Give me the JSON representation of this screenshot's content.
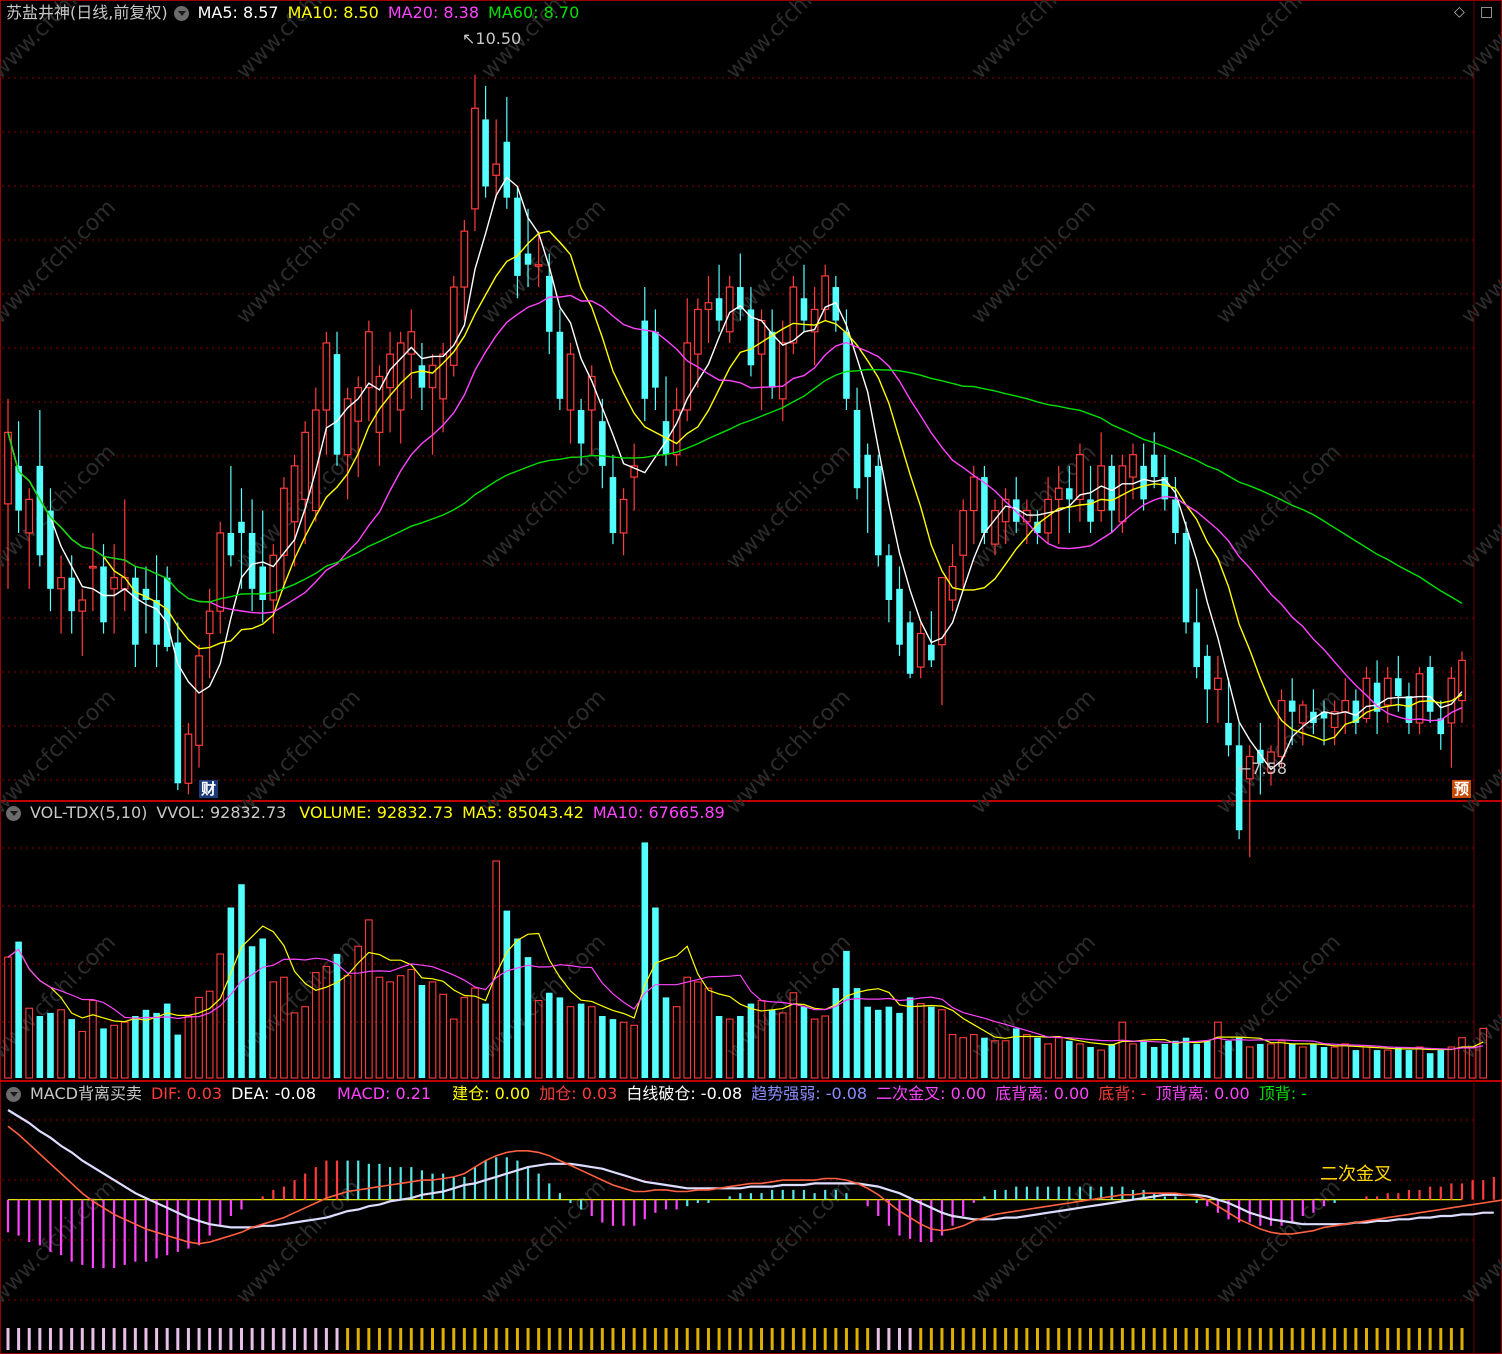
{
  "header": {
    "title": "苏盐井神(日线,前复权)",
    "ma5": "MA5: 8.57",
    "ma10": "MA10: 8.50",
    "ma20": "MA20: 8.38",
    "ma60": "MA60: 8.70"
  },
  "vol_header": {
    "name": "VOL-TDX(5,10)",
    "vvol": "VVOL: 92832.73",
    "volume": "VOLUME: 92832.73",
    "ma5": "MA5: 85043.42",
    "ma10": "MA10: 67665.89"
  },
  "macd_header": {
    "name": "MACD背离买卖",
    "dif": "DIF: 0.03",
    "dea": "DEA: -0.08",
    "macd": "MACD: 0.21",
    "jiancang": "建仓: 0.00",
    "jiacang": "加仓: 0.03",
    "baixian": "白线破仓: -0.08",
    "qushi": "趋势强弱: -0.08",
    "erci": "二次金叉: 0.00",
    "dibeili": "底背离: 0.00",
    "dibei": "底背: -",
    "dingbeili": "顶背离: 0.00",
    "dingbei": "顶背: -"
  },
  "annotations": {
    "high": "10.50",
    "low": "7.58",
    "erci_label": "二次金叉",
    "cai_badge": "财",
    "yu_badge": "预",
    "watermark": "www.cfchi.com"
  },
  "colors": {
    "up": "#ff3b3b",
    "down": "#54ffff",
    "ma5": "#ffffff",
    "ma10": "#ffff00",
    "ma20": "#ff44ff",
    "ma60": "#00e000",
    "grid": "#8a0000"
  },
  "chart_data": [
    {
      "type": "candlestick",
      "title": "苏盐井神(日线,前复权)",
      "ylim": [
        7.3,
        10.7
      ],
      "yhigh": 10.5,
      "ylow": 7.58,
      "ohlc": [
        [
          8.58,
          9.05,
          8.2,
          8.9
        ],
        [
          8.75,
          8.95,
          8.45,
          8.55
        ],
        [
          8.45,
          8.65,
          8.2,
          8.6
        ],
        [
          8.75,
          9.0,
          8.3,
          8.35
        ],
        [
          8.55,
          8.65,
          8.1,
          8.2
        ],
        [
          8.2,
          8.35,
          8.0,
          8.25
        ],
        [
          8.25,
          8.35,
          8.0,
          8.1
        ],
        [
          8.1,
          8.2,
          7.9,
          8.15
        ],
        [
          8.3,
          8.45,
          8.1,
          8.3
        ],
        [
          8.3,
          8.4,
          8.0,
          8.05
        ],
        [
          8.2,
          8.4,
          8.0,
          8.25
        ],
        [
          8.2,
          8.6,
          8.1,
          8.25
        ],
        [
          8.25,
          8.3,
          7.85,
          7.95
        ],
        [
          8.2,
          8.3,
          8.0,
          8.15
        ],
        [
          8.15,
          8.35,
          7.85,
          7.95
        ],
        [
          8.25,
          8.3,
          7.92,
          7.94
        ],
        [
          7.96,
          8.05,
          7.3,
          7.33
        ],
        [
          7.33,
          7.6,
          7.28,
          7.55
        ],
        [
          7.5,
          7.95,
          7.4,
          7.9
        ],
        [
          8.0,
          8.2,
          7.8,
          8.1
        ],
        [
          8.1,
          8.5,
          8.0,
          8.45
        ],
        [
          8.45,
          8.75,
          8.3,
          8.35
        ],
        [
          8.5,
          8.65,
          8.2,
          8.45
        ],
        [
          8.45,
          8.6,
          8.1,
          8.2
        ],
        [
          8.3,
          8.55,
          8.05,
          8.15
        ],
        [
          8.15,
          8.4,
          8.0,
          8.35
        ],
        [
          8.35,
          8.7,
          8.2,
          8.65
        ],
        [
          8.5,
          8.8,
          8.3,
          8.75
        ],
        [
          8.6,
          8.95,
          8.4,
          8.9
        ],
        [
          8.55,
          9.1,
          8.5,
          9.0
        ],
        [
          9.0,
          9.35,
          8.8,
          9.3
        ],
        [
          9.25,
          9.35,
          8.75,
          8.8
        ],
        [
          8.8,
          9.1,
          8.6,
          9.05
        ],
        [
          8.95,
          9.15,
          8.7,
          9.1
        ],
        [
          9.1,
          9.4,
          8.95,
          9.35
        ],
        [
          8.9,
          9.2,
          8.75,
          9.15
        ],
        [
          9.1,
          9.35,
          8.9,
          9.25
        ],
        [
          9.0,
          9.35,
          8.85,
          9.3
        ],
        [
          9.25,
          9.45,
          9.05,
          9.35
        ],
        [
          9.2,
          9.3,
          9.0,
          9.1
        ],
        [
          9.1,
          9.25,
          8.8,
          9.2
        ],
        [
          9.05,
          9.3,
          8.9,
          9.25
        ],
        [
          9.2,
          9.6,
          9.15,
          9.55
        ],
        [
          9.55,
          9.85,
          9.4,
          9.8
        ],
        [
          9.9,
          10.5,
          9.8,
          10.35
        ],
        [
          10.3,
          10.45,
          9.95,
          10.0
        ],
        [
          10.05,
          10.3,
          9.95,
          10.1
        ],
        [
          10.2,
          10.4,
          9.9,
          9.95
        ],
        [
          9.95,
          10.0,
          9.5,
          9.6
        ],
        [
          9.7,
          9.9,
          9.55,
          9.65
        ],
        [
          9.65,
          9.8,
          9.55,
          9.65
        ],
        [
          9.6,
          9.7,
          9.25,
          9.35
        ],
        [
          9.35,
          9.45,
          9.0,
          9.05
        ],
        [
          9.0,
          9.3,
          8.85,
          9.25
        ],
        [
          9.0,
          9.05,
          8.75,
          8.85
        ],
        [
          9.0,
          9.2,
          8.8,
          9.15
        ],
        [
          8.95,
          9.05,
          8.65,
          8.75
        ],
        [
          8.7,
          8.8,
          8.4,
          8.45
        ],
        [
          8.45,
          8.65,
          8.35,
          8.6
        ],
        [
          8.7,
          8.85,
          8.55,
          8.75
        ],
        [
          9.4,
          9.55,
          8.95,
          9.05
        ],
        [
          9.35,
          9.45,
          9.0,
          9.1
        ],
        [
          8.95,
          9.15,
          8.75,
          8.8
        ],
        [
          8.8,
          9.1,
          8.75,
          9.0
        ],
        [
          9.0,
          9.5,
          8.95,
          9.3
        ],
        [
          9.25,
          9.5,
          9.1,
          9.45
        ],
        [
          9.45,
          9.6,
          9.3,
          9.48
        ],
        [
          9.5,
          9.65,
          9.35,
          9.4
        ],
        [
          9.35,
          9.6,
          9.3,
          9.55
        ],
        [
          9.55,
          9.7,
          9.4,
          9.45
        ],
        [
          9.45,
          9.55,
          9.15,
          9.2
        ],
        [
          9.25,
          9.45,
          9.0,
          9.4
        ],
        [
          9.35,
          9.45,
          9.05,
          9.1
        ],
        [
          9.05,
          9.4,
          8.95,
          9.3
        ],
        [
          9.3,
          9.6,
          9.25,
          9.55
        ],
        [
          9.5,
          9.65,
          9.35,
          9.4
        ],
        [
          9.35,
          9.55,
          9.2,
          9.45
        ],
        [
          9.45,
          9.65,
          9.4,
          9.6
        ],
        [
          9.55,
          9.6,
          9.35,
          9.4
        ],
        [
          9.35,
          9.45,
          9.0,
          9.05
        ],
        [
          9.0,
          9.1,
          8.6,
          8.65
        ],
        [
          8.8,
          8.85,
          8.45,
          8.7
        ],
        [
          8.75,
          8.8,
          8.3,
          8.35
        ],
        [
          8.35,
          8.4,
          8.05,
          8.15
        ],
        [
          8.2,
          8.3,
          7.9,
          7.95
        ],
        [
          8.05,
          8.1,
          7.8,
          7.82
        ],
        [
          7.85,
          8.05,
          7.8,
          8.0
        ],
        [
          7.95,
          8.1,
          7.85,
          7.88
        ],
        [
          7.95,
          8.2,
          7.68,
          8.25
        ],
        [
          8.15,
          8.4,
          8.1,
          8.3
        ],
        [
          8.35,
          8.6,
          8.2,
          8.55
        ],
        [
          8.55,
          8.75,
          8.4,
          8.7
        ],
        [
          8.7,
          8.75,
          8.4,
          8.45
        ],
        [
          8.4,
          8.6,
          8.35,
          8.55
        ],
        [
          8.5,
          8.65,
          8.4,
          8.6
        ],
        [
          8.6,
          8.7,
          8.45,
          8.5
        ],
        [
          8.5,
          8.6,
          8.4,
          8.55
        ],
        [
          8.5,
          8.55,
          8.4,
          8.45
        ],
        [
          8.45,
          8.7,
          8.4,
          8.6
        ],
        [
          8.6,
          8.75,
          8.4,
          8.65
        ],
        [
          8.65,
          8.75,
          8.45,
          8.6
        ],
        [
          8.6,
          8.85,
          8.5,
          8.8
        ],
        [
          8.6,
          8.75,
          8.45,
          8.5
        ],
        [
          8.55,
          8.9,
          8.5,
          8.75
        ],
        [
          8.75,
          8.8,
          8.45,
          8.55
        ],
        [
          8.5,
          8.8,
          8.45,
          8.75
        ],
        [
          8.7,
          8.85,
          8.6,
          8.8
        ],
        [
          8.75,
          8.85,
          8.55,
          8.6
        ],
        [
          8.8,
          8.9,
          8.65,
          8.7
        ],
        [
          8.7,
          8.8,
          8.55,
          8.6
        ],
        [
          8.6,
          8.7,
          8.4,
          8.45
        ],
        [
          8.45,
          8.5,
          8.0,
          8.05
        ],
        [
          8.05,
          8.2,
          7.8,
          7.85
        ],
        [
          7.9,
          7.95,
          7.6,
          7.75
        ],
        [
          7.75,
          7.9,
          7.6,
          7.8
        ],
        [
          7.6,
          7.8,
          7.45,
          7.5
        ],
        [
          7.5,
          7.6,
          7.08,
          7.12
        ],
        [
          7.35,
          7.5,
          7.0,
          7.45
        ],
        [
          7.48,
          7.6,
          7.28,
          7.42
        ],
        [
          7.38,
          7.5,
          7.32,
          7.47
        ],
        [
          7.45,
          7.75,
          7.4,
          7.7
        ],
        [
          7.7,
          7.8,
          7.5,
          7.65
        ],
        [
          7.6,
          7.7,
          7.5,
          7.68
        ],
        [
          7.65,
          7.75,
          7.55,
          7.6
        ],
        [
          7.65,
          7.7,
          7.5,
          7.62
        ],
        [
          7.58,
          7.7,
          7.5,
          7.65
        ],
        [
          7.65,
          7.8,
          7.55,
          7.7
        ],
        [
          7.7,
          7.75,
          7.55,
          7.6
        ],
        [
          7.62,
          7.85,
          7.6,
          7.8
        ],
        [
          7.78,
          7.88,
          7.55,
          7.65
        ],
        [
          7.68,
          7.85,
          7.6,
          7.8
        ],
        [
          7.8,
          7.9,
          7.65,
          7.72
        ],
        [
          7.72,
          7.78,
          7.55,
          7.6
        ],
        [
          7.6,
          7.85,
          7.55,
          7.82
        ],
        [
          7.85,
          7.9,
          7.6,
          7.65
        ],
        [
          7.62,
          7.7,
          7.48,
          7.55
        ],
        [
          7.6,
          7.85,
          7.4,
          7.8
        ],
        [
          7.7,
          7.92,
          7.6,
          7.88
        ]
      ]
    },
    {
      "type": "bar",
      "title": "VOL-TDX(5,10)",
      "ylim": [
        0,
        160000
      ],
      "values": [
        78000,
        88000,
        45000,
        40000,
        42000,
        44000,
        38000,
        30000,
        50000,
        32000,
        34000,
        36000,
        40000,
        44000,
        42000,
        48000,
        28000,
        40000,
        52000,
        56000,
        80000,
        110000,
        125000,
        85000,
        90000,
        62000,
        65000,
        42000,
        46000,
        68000,
        72000,
        80000,
        66000,
        85000,
        102000,
        65000,
        62000,
        66000,
        70000,
        60000,
        62000,
        54000,
        38000,
        52000,
        58000,
        48000,
        140000,
        108000,
        90000,
        78000,
        50000,
        55000,
        52000,
        46000,
        48000,
        46000,
        40000,
        38000,
        36000,
        34000,
        152000,
        110000,
        52000,
        46000,
        65000,
        62000,
        58000,
        40000,
        38000,
        40000,
        48000,
        50000,
        44000,
        42000,
        55000,
        46000,
        38000,
        40000,
        58000,
        82000,
        58000,
        46000,
        44000,
        46000,
        42000,
        52000,
        48000,
        46000,
        44000,
        28000,
        26000,
        28000,
        26000,
        24000,
        24000,
        32000,
        28000,
        26000,
        22000,
        26000,
        24000,
        22000,
        20000,
        18000,
        22000,
        36000,
        22000,
        24000,
        20000,
        22000,
        24000,
        26000,
        22000,
        24000,
        36000,
        24000,
        26000,
        20000,
        22000,
        22000,
        24000,
        22000,
        20000,
        22000,
        20000,
        20000,
        22000,
        18000,
        20000,
        18000,
        18000,
        20000,
        18000,
        20000,
        16000,
        18000,
        20000,
        26000,
        20000,
        32000
      ]
    },
    {
      "type": "line",
      "title": "MACD背离买卖",
      "ylim": [
        -0.75,
        0.55
      ],
      "dif": [
        0.45,
        0.4,
        0.34,
        0.28,
        0.22,
        0.16,
        0.1,
        0.04,
        -0.01,
        -0.05,
        -0.09,
        -0.12,
        -0.15,
        -0.18,
        -0.2,
        -0.22,
        -0.24,
        -0.26,
        -0.27,
        -0.26,
        -0.24,
        -0.22,
        -0.2,
        -0.17,
        -0.15,
        -0.13,
        -0.11,
        -0.08,
        -0.05,
        -0.02,
        0.01,
        0.03,
        0.05,
        0.06,
        0.07,
        0.08,
        0.09,
        0.1,
        0.11,
        0.12,
        0.12,
        0.13,
        0.14,
        0.16,
        0.2,
        0.24,
        0.27,
        0.29,
        0.3,
        0.3,
        0.29,
        0.27,
        0.24,
        0.21,
        0.18,
        0.15,
        0.12,
        0.09,
        0.07,
        0.05,
        0.05,
        0.06,
        0.06,
        0.05,
        0.05,
        0.06,
        0.06,
        0.07,
        0.08,
        0.09,
        0.1,
        0.1,
        0.11,
        0.12,
        0.12,
        0.12,
        0.12,
        0.13,
        0.13,
        0.12,
        0.1,
        0.07,
        0.03,
        -0.02,
        -0.07,
        -0.11,
        -0.15,
        -0.18,
        -0.19,
        -0.18,
        -0.16,
        -0.13,
        -0.11,
        -0.09,
        -0.08,
        -0.07,
        -0.06,
        -0.05,
        -0.04,
        -0.03,
        -0.02,
        -0.01,
        0.0,
        0.01,
        0.02,
        0.03,
        0.03,
        0.04,
        0.04,
        0.04,
        0.04,
        0.03,
        0.02,
        0.0,
        -0.04,
        -0.08,
        -0.12,
        -0.15,
        -0.18,
        -0.2,
        -0.21,
        -0.21,
        -0.2,
        -0.19,
        -0.17,
        -0.16,
        -0.15,
        -0.14,
        -0.13,
        -0.12,
        -0.11,
        -0.1,
        -0.09,
        -0.08,
        -0.07,
        -0.06,
        -0.05,
        -0.04,
        -0.03,
        -0.02,
        -0.01,
        0.0,
        0.03
      ],
      "dea": [
        0.55,
        0.51,
        0.47,
        0.42,
        0.38,
        0.33,
        0.29,
        0.24,
        0.2,
        0.16,
        0.12,
        0.08,
        0.04,
        0.01,
        -0.02,
        -0.05,
        -0.08,
        -0.11,
        -0.13,
        -0.15,
        -0.16,
        -0.17,
        -0.17,
        -0.17,
        -0.16,
        -0.16,
        -0.15,
        -0.14,
        -0.13,
        -0.12,
        -0.11,
        -0.09,
        -0.07,
        -0.06,
        -0.04,
        -0.03,
        -0.01,
        0.0,
        0.01,
        0.03,
        0.04,
        0.05,
        0.07,
        0.09,
        0.1,
        0.12,
        0.14,
        0.16,
        0.18,
        0.2,
        0.21,
        0.22,
        0.22,
        0.22,
        0.21,
        0.2,
        0.19,
        0.17,
        0.15,
        0.13,
        0.11,
        0.1,
        0.09,
        0.08,
        0.07,
        0.07,
        0.07,
        0.07,
        0.07,
        0.07,
        0.08,
        0.08,
        0.08,
        0.09,
        0.09,
        0.09,
        0.1,
        0.1,
        0.1,
        0.1,
        0.1,
        0.09,
        0.08,
        0.06,
        0.04,
        0.01,
        -0.02,
        -0.05,
        -0.08,
        -0.1,
        -0.11,
        -0.12,
        -0.12,
        -0.12,
        -0.11,
        -0.11,
        -0.1,
        -0.09,
        -0.08,
        -0.07,
        -0.06,
        -0.05,
        -0.04,
        -0.03,
        -0.02,
        -0.01,
        0.0,
        0.01,
        0.02,
        0.03,
        0.03,
        0.03,
        0.03,
        0.02,
        0.0,
        -0.02,
        -0.05,
        -0.08,
        -0.1,
        -0.12,
        -0.13,
        -0.14,
        -0.15,
        -0.15,
        -0.15,
        -0.15,
        -0.15,
        -0.14,
        -0.14,
        -0.13,
        -0.13,
        -0.12,
        -0.12,
        -0.11,
        -0.11,
        -0.1,
        -0.1,
        -0.09,
        -0.09,
        -0.08,
        -0.08
      ]
    }
  ]
}
